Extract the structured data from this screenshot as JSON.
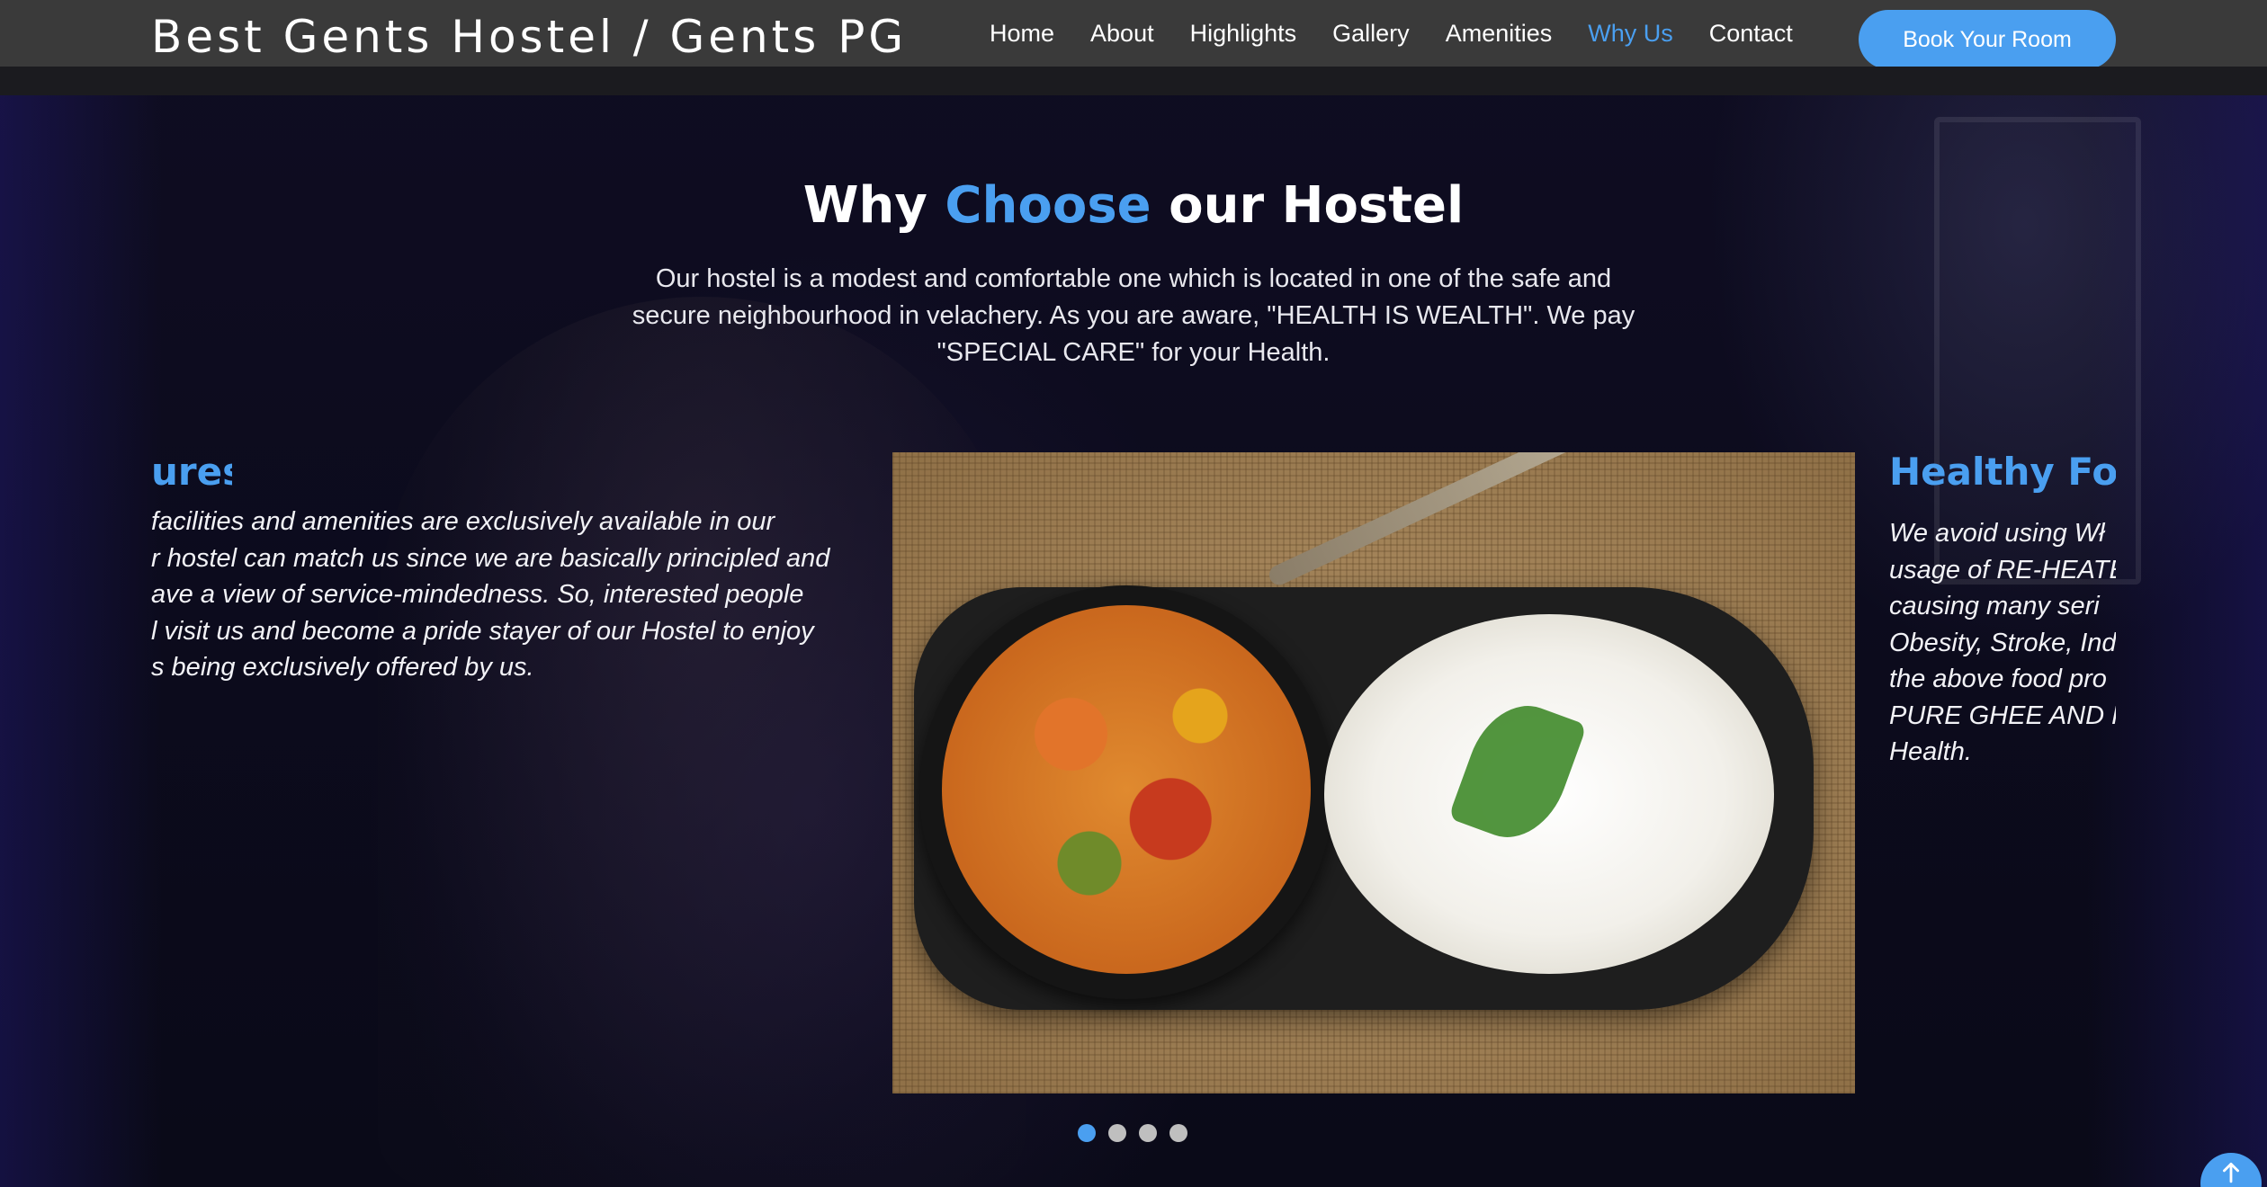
{
  "header": {
    "brand": "Best Gents Hostel / Gents PG",
    "nav": [
      {
        "label": "Home",
        "active": false
      },
      {
        "label": "About",
        "active": false
      },
      {
        "label": "Highlights",
        "active": false
      },
      {
        "label": "Gallery",
        "active": false
      },
      {
        "label": "Amenities",
        "active": false
      },
      {
        "label": "Why Us",
        "active": true
      },
      {
        "label": "Contact",
        "active": false
      }
    ],
    "cta_label": "Book Your Room"
  },
  "section": {
    "title_before": "Why ",
    "title_accent": "Choose",
    "title_after": " our Hostel",
    "description": "Our hostel is a modest and comfortable one which is located in one of the safe and secure neighbourhood in velachery. As you are aware, \"HEALTH IS WEALTH\". We pay \"SPECIAL CARE\" for your Health."
  },
  "carousel": {
    "prev_slide": {
      "heading": "ures",
      "lines": [
        "facilities and amenities are exclusively available in our",
        "r hostel can match us since we are basically principled and",
        "ave a view of service-mindedness. So, interested people",
        "l visit us and become a pride stayer of our Hostel to enjoy",
        "s being exclusively offered by us."
      ]
    },
    "next_slide": {
      "heading": "Healthy Foc",
      "lines": [
        "We avoid using Wł",
        "usage of RE-HEATE",
        "causing many seri",
        "Obesity, Stroke, Ind",
        "the above food pro",
        "PURE GHEE AND PUI",
        "Health."
      ]
    },
    "image_alt": "vegetable curry with rice",
    "dots": [
      {
        "active": true
      },
      {
        "active": false
      },
      {
        "active": false
      },
      {
        "active": false
      }
    ]
  },
  "colors": {
    "accent": "#4a9ff0",
    "navbar": "#3a3a3a",
    "background": "#0c0b1d"
  },
  "icons": {
    "back_to_top": "arrow-up-icon"
  }
}
